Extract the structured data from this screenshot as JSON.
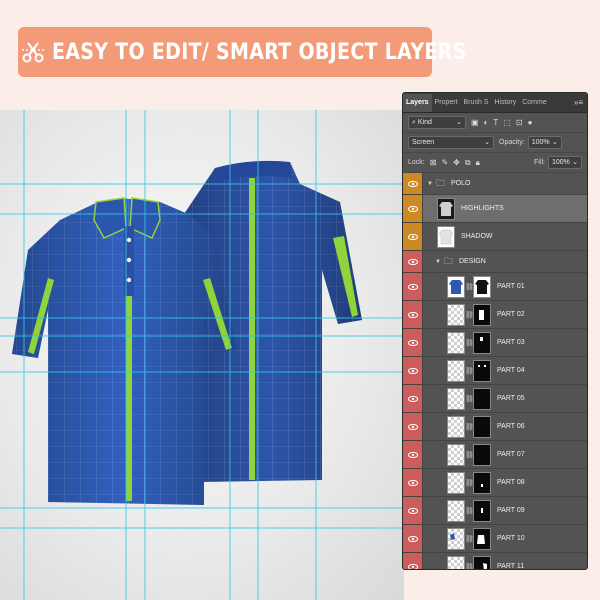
{
  "banner": {
    "title": "EASY TO EDIT/ SMART OBJECT LAYERS",
    "icon": "scissors-icon",
    "color": "#f39b78"
  },
  "canvas": {
    "shirt_color": "#2f58b0",
    "stripe_color": "#8fd43a",
    "guide_color": "#33c7e6"
  },
  "panel": {
    "tabs": [
      "Layers",
      "Propert",
      "Brush S",
      "History",
      "Comme"
    ],
    "active_tab": "Layers",
    "filter_kind": "Kind",
    "blend_mode": "Screen",
    "opacity_label": "Opacity:",
    "opacity_value": "100%",
    "lock_label": "Lock:",
    "fill_label": "Fill:",
    "fill_value": "100%",
    "layers": [
      {
        "name": "POLO",
        "type": "group",
        "eye": "orange"
      },
      {
        "name": "HIGHLIGHTS",
        "type": "layer",
        "eye": "orange",
        "selected": true
      },
      {
        "name": "SHADOW",
        "type": "layer",
        "eye": "orange"
      },
      {
        "name": "DESIGN",
        "type": "group",
        "eye": "red"
      },
      {
        "name": "PART 01",
        "type": "smart",
        "eye": "red"
      },
      {
        "name": "PART 02",
        "type": "smart",
        "eye": "red"
      },
      {
        "name": "PART 03",
        "type": "smart",
        "eye": "red"
      },
      {
        "name": "PART 04",
        "type": "smart",
        "eye": "red"
      },
      {
        "name": "PART 05",
        "type": "smart",
        "eye": "red"
      },
      {
        "name": "PART 06",
        "type": "smart",
        "eye": "red"
      },
      {
        "name": "PART 07",
        "type": "smart",
        "eye": "red"
      },
      {
        "name": "PART 08",
        "type": "smart",
        "eye": "red"
      },
      {
        "name": "PART 09",
        "type": "smart",
        "eye": "red"
      },
      {
        "name": "PART 10",
        "type": "smart",
        "eye": "red"
      },
      {
        "name": "PART 11",
        "type": "smart",
        "eye": "red"
      }
    ]
  }
}
